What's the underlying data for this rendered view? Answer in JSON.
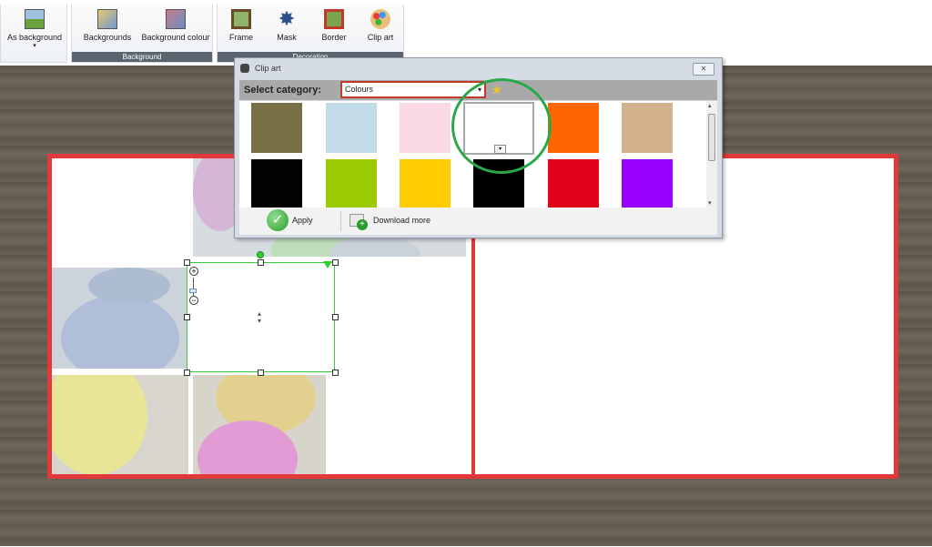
{
  "ribbon": {
    "as_background_label": "As background",
    "background_group_label": "Background",
    "decoration_group_label": "Decoration",
    "buttons": [
      "Backgrounds",
      "Background colour",
      "Frame",
      "Mask",
      "Border",
      "Clip art"
    ]
  },
  "dialog": {
    "title": "Clip art",
    "category_label": "Select category:",
    "category_value": "Colours",
    "apply_label": "Apply",
    "download_label": "Download more"
  },
  "swatches": [
    "#787044",
    "#c3dae9",
    "#fbd9e4",
    "#ffffff",
    "#fe6601",
    "#d1b28d",
    "#020202",
    "#9acb02",
    "#fecc00",
    "#000000",
    "#e0001a",
    "#9801ff"
  ],
  "colors": {
    "book_border": "#e2393b",
    "selection": "#31cd31",
    "highlight_circle": "#2aa84a",
    "category_border": "#c0392b"
  }
}
